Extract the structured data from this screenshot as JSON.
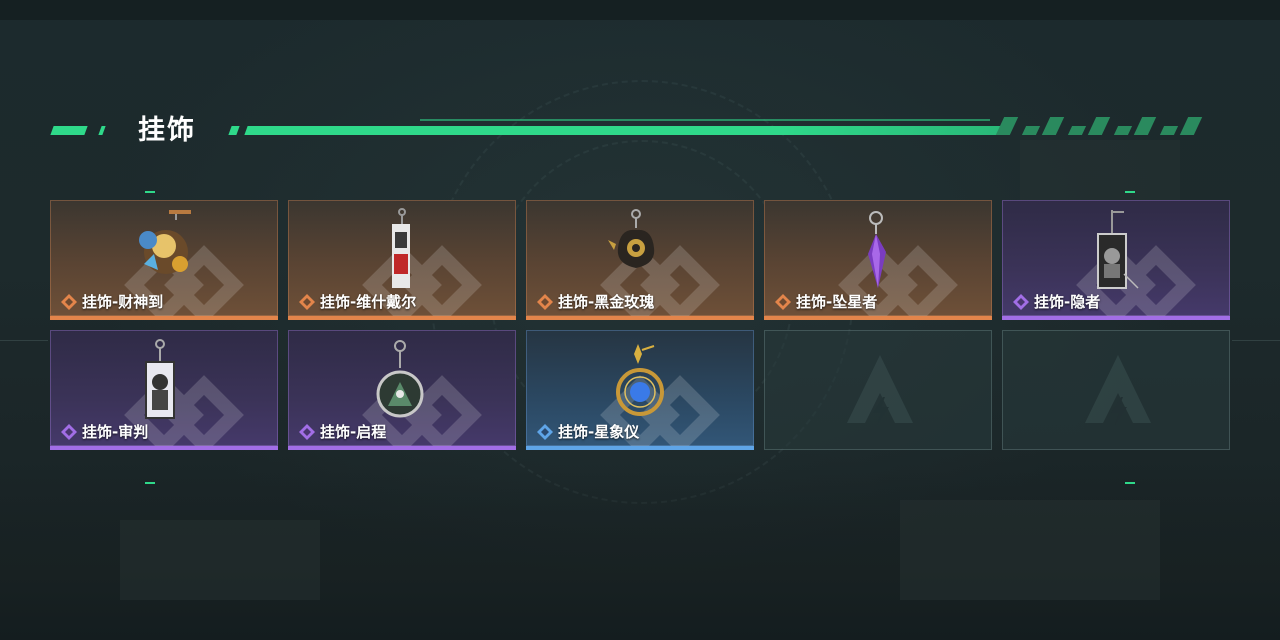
{
  "section": {
    "title": "挂饰"
  },
  "colors": {
    "accent": "#2fd98a",
    "orange": "#e3854b",
    "purple": "#a26ee6",
    "blue": "#5fa5e8"
  },
  "items": [
    {
      "name": "挂饰-财神到",
      "rarity": "orange",
      "icon": "fortune-god-charm-icon"
    },
    {
      "name": "挂饰-维什戴尔",
      "rarity": "orange",
      "icon": "wisadel-charm-icon"
    },
    {
      "name": "挂饰-黑金玫瑰",
      "rarity": "orange",
      "icon": "black-gold-rose-charm-icon"
    },
    {
      "name": "挂饰-坠星者",
      "rarity": "orange",
      "icon": "star-fall-crystal-charm-icon"
    },
    {
      "name": "挂饰-隐者",
      "rarity": "purple",
      "icon": "hermit-tarot-charm-icon"
    },
    {
      "name": "挂饰-审判",
      "rarity": "purple",
      "icon": "judgement-tarot-charm-icon"
    },
    {
      "name": "挂饰-启程",
      "rarity": "purple",
      "icon": "departure-ring-charm-icon"
    },
    {
      "name": "挂饰-星象仪",
      "rarity": "blue",
      "icon": "astrolabe-charm-icon"
    }
  ],
  "empty_slots": 2
}
